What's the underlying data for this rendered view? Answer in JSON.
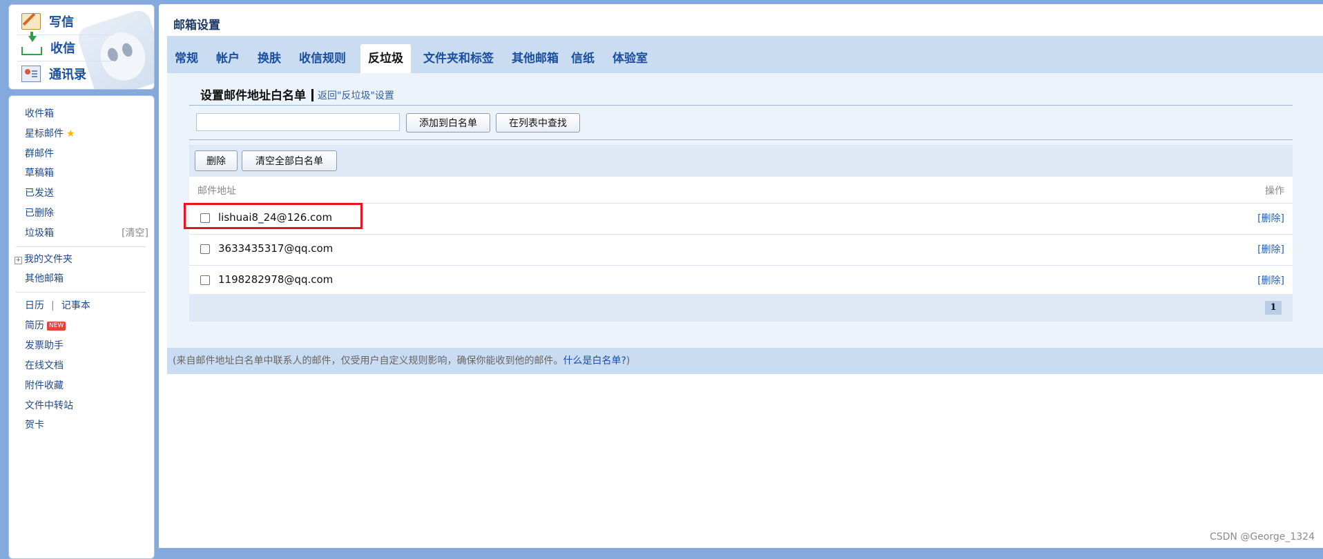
{
  "compose": {
    "write_label": "写信",
    "inbox_label": "收信",
    "contacts_label": "通讯录"
  },
  "folders": {
    "inbox": "收件箱",
    "starred": "星标邮件",
    "group": "群邮件",
    "drafts": "草稿箱",
    "sent": "已发送",
    "deleted": "已删除",
    "spam": "垃圾箱",
    "spam_clear": "[清空]",
    "my_folders": "我的文件夹",
    "other_mailboxes": "其他邮箱",
    "calendar": "日历",
    "notepad": "记事本",
    "resume": "简历",
    "resume_badge": "NEW",
    "invoice": "发票助手",
    "docs": "在线文档",
    "attachments": "附件收藏",
    "transfer": "文件中转站",
    "cards": "贺卡"
  },
  "main": {
    "title": "邮箱设置",
    "tabs": [
      {
        "label": "常规"
      },
      {
        "label": "帐户"
      },
      {
        "label": "换肤"
      },
      {
        "label": "收信规则"
      },
      {
        "label": "反垃圾",
        "active": true
      },
      {
        "label": "文件夹和标签"
      },
      {
        "label": "其他邮箱"
      },
      {
        "label": "信纸"
      },
      {
        "label": "体验室"
      }
    ],
    "section_title": "设置邮件地址白名单",
    "back_link": "返回\"反垃圾\"设置",
    "input_value": "",
    "add_button": "添加到白名单",
    "search_button": "在列表中查找",
    "delete_button": "删除",
    "clear_button": "清空全部白名单",
    "col_address": "邮件地址",
    "col_action": "操作",
    "rows": [
      {
        "address": "lishuai8_24@126.com",
        "action": "[删除]",
        "highlighted": true
      },
      {
        "address": "3633435317@qq.com",
        "action": "[删除]"
      },
      {
        "address": "1198282978@qq.com",
        "action": "[删除]"
      }
    ],
    "page": "1",
    "note_prefix": "(来自邮件地址白名单中联系人的邮件，仅受用户自定义规则影响，确保你能收到他的邮件。",
    "note_link": "什么是白名单?",
    "note_suffix": ")"
  },
  "watermark": "CSDN @George_1324",
  "colors": {
    "background": "#84a9dc",
    "tab_bar": "#c9dcf2",
    "link": "#2b5fa9",
    "highlight_box": "#e8141d"
  }
}
